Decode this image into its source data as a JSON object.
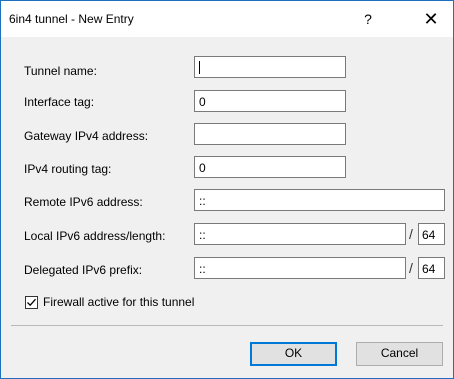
{
  "window": {
    "title": "6in4 tunnel - New Entry",
    "help_label": "?",
    "close_label": "✕"
  },
  "form": {
    "tunnel_name": {
      "label": "Tunnel name:",
      "value": ""
    },
    "interface_tag": {
      "label": "Interface tag:",
      "value": "0"
    },
    "gateway_ipv4": {
      "label": "Gateway IPv4 address:",
      "value": ""
    },
    "ipv4_routing_tag": {
      "label": "IPv4 routing tag:",
      "value": "0"
    },
    "remote_ipv6": {
      "label": "Remote IPv6 address:",
      "value": "::"
    },
    "local_ipv6": {
      "label": "Local IPv6 address/length:",
      "value": "::",
      "separator": "/",
      "length": "64"
    },
    "delegated_prefix": {
      "label": "Delegated IPv6 prefix:",
      "value": "::",
      "separator": "/",
      "length": "64"
    },
    "firewall": {
      "label": "Firewall active for this tunnel",
      "checked": true
    }
  },
  "buttons": {
    "ok_label": "OK",
    "cancel_label": "Cancel"
  },
  "colors": {
    "accent": "#0078d7",
    "window_border": "#1f6fbf",
    "dialog_bg": "#f0f0f0"
  }
}
